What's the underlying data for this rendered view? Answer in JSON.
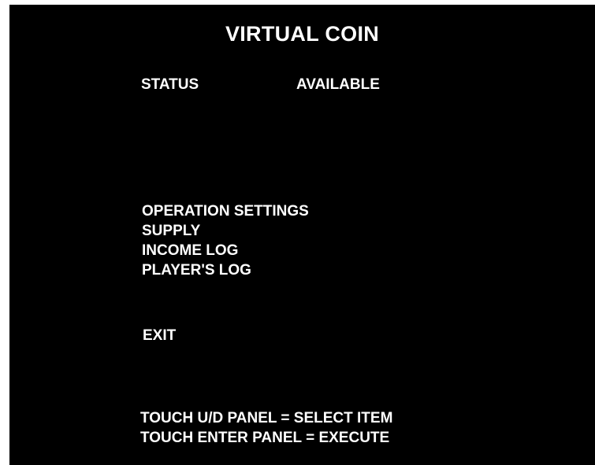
{
  "screen": {
    "title": "VIRTUAL COIN",
    "status": {
      "label": "STATUS",
      "value": "AVAILABLE"
    },
    "menu": [
      {
        "label": "OPERATION SETTINGS"
      },
      {
        "label": "SUPPLY"
      },
      {
        "label": "INCOME LOG"
      },
      {
        "label": "PLAYER'S LOG"
      }
    ],
    "exit_label": "EXIT",
    "instructions": [
      "TOUCH U/D PANEL = SELECT ITEM",
      "TOUCH ENTER PANEL = EXECUTE"
    ]
  },
  "colors": {
    "background": "#000000",
    "text": "#ffffff"
  }
}
